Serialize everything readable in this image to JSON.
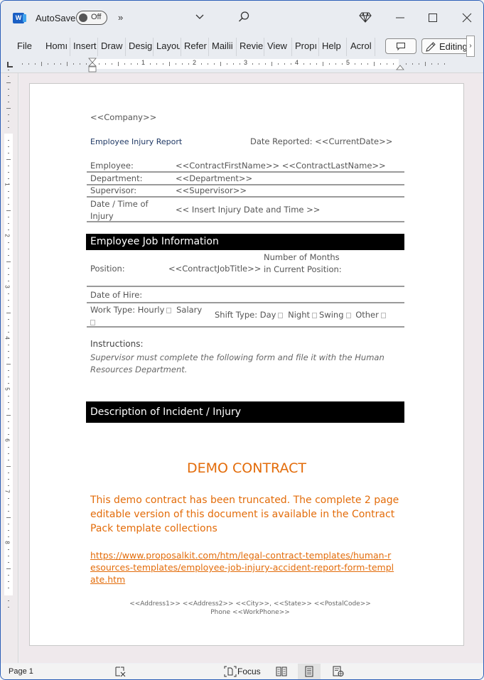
{
  "titlebar": {
    "autosave_label": "AutoSave",
    "autosave_state": "Off",
    "more_label": "»"
  },
  "ribbon": {
    "tabs": [
      "File",
      "Home",
      "Insert",
      "Draw",
      "Design",
      "Layout",
      "References",
      "Mailings",
      "Review",
      "View",
      "Properties",
      "Help",
      "Acrobat"
    ],
    "tabs_visible": [
      "File",
      "Homı",
      "Insert",
      "Draw",
      "Desig",
      "Layou",
      "Refer",
      "Mailii",
      "Revie",
      "View",
      "Propı",
      "Help",
      "Acrol"
    ],
    "editing_label": "Editing",
    "scroll_label": "›"
  },
  "ruler": {
    "numbers": [
      "1",
      "2",
      "3",
      "4",
      "5"
    ],
    "vertical_numbers": [
      "1",
      "2",
      "3",
      "4",
      "5",
      "6",
      "7",
      "8"
    ]
  },
  "document": {
    "company": "<<Company>>",
    "report_title": "Employee Injury Report",
    "date_reported": "Date Reported: <<CurrentDate>>",
    "employee_rows": [
      {
        "label": "Employee:",
        "value": "<<ContractFirstName>> <<ContractLastName>>"
      },
      {
        "label": "Department:",
        "value": "<<Department>>"
      },
      {
        "label": "Supervisor:",
        "value": "<<Supervisor>>"
      },
      {
        "label": "Date / Time of Injury",
        "value": "<< Insert Injury Date and Time >>"
      }
    ],
    "job_section_title": "Employee Job Information",
    "job": {
      "position_label": "Position:",
      "position_value": "<<ContractJobTitle>>",
      "months_label": "Number of Months in Current Position:",
      "hire_label": "Date of Hire:",
      "work_type_label": "Work Type:",
      "work_types": [
        "Hourly",
        "Salary"
      ],
      "shift_type_label": "Shift Type:",
      "shift_types": [
        "Day",
        "Night",
        "Swing",
        "Other"
      ]
    },
    "instructions_label": "Instructions:",
    "instructions_text": "Supervisor must complete the following form and file it with the Human Resources Department.",
    "incident_section_title": "Description of Incident / Injury",
    "demo_title": "DEMO CONTRACT",
    "demo_body": "This demo contract has been truncated. The complete 2 page editable version of this document is available in the Contract Pack template collections",
    "demo_link": "https://www.proposalkit.com/htm/legal-contract-templates/human-resources-templates/employee-job-injury-accident-report-form-template.htm",
    "footer_address": "<<Address1>> <<Address2>> <<City>>, <<State>> <<PostalCode>>",
    "footer_phone": "Phone <<WorkPhone>>"
  },
  "statusbar": {
    "page": "Page 1",
    "focus_label": "Focus"
  },
  "colors": {
    "accent_orange": "#e36c0a",
    "title_navy": "#1f3864",
    "window_border": "#2c5fb8",
    "word_blue": "#1a5fc4"
  }
}
